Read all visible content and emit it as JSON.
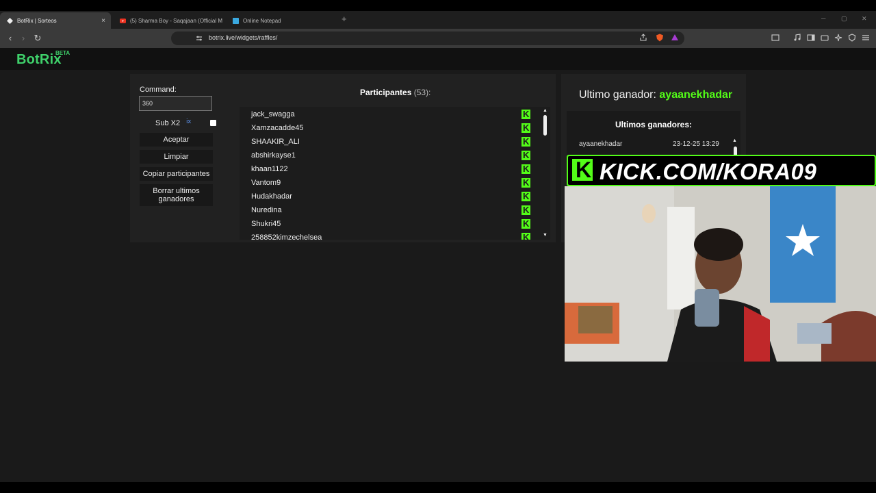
{
  "browser": {
    "tabs": [
      {
        "title": "BotRix | Sorteos",
        "close": "×"
      },
      {
        "title": "(5) Sharma Boy - Saqajaan (Official M"
      },
      {
        "title": "Online Notepad"
      }
    ],
    "new_tab": "+",
    "url": "botrix.live/widgets/raffles/"
  },
  "header": {
    "logo": "BotRix",
    "beta": "BETA"
  },
  "raffle": {
    "command_label": "Command:",
    "command_value": "360",
    "sub_label": "Sub X2",
    "sub_mark": "ⅸ",
    "buttons": {
      "accept": "Aceptar",
      "clear": "Limpiar",
      "copy": "Copiar participantes",
      "delete": "Borrar ultimos ganadores"
    },
    "participants_title": "Participantes",
    "participants_count": "(53):",
    "participants": [
      "jack_swagga",
      "Xamzacadde45",
      "SHAAKIR_ALI",
      "abshirkayse1",
      "khaan1122",
      "Vantom9",
      "Hudakhadar",
      "Nuredina",
      "Shukri45",
      "258852kimzechelsea"
    ],
    "platform_badge": "K"
  },
  "winners": {
    "last_winner_label": "Ultimo ganador:",
    "last_winner_name": "ayaanekhadar",
    "recent_title": "Ultimos ganadores:",
    "recent": [
      {
        "name": "ayaanekhadar",
        "date": "23-12-25 13:29"
      }
    ]
  },
  "overlay": {
    "banner_logo": "K",
    "banner_text": "KICK.COM/KORA09"
  },
  "colors": {
    "kick_green": "#53fc18",
    "botrix_green": "#3fd16b"
  }
}
